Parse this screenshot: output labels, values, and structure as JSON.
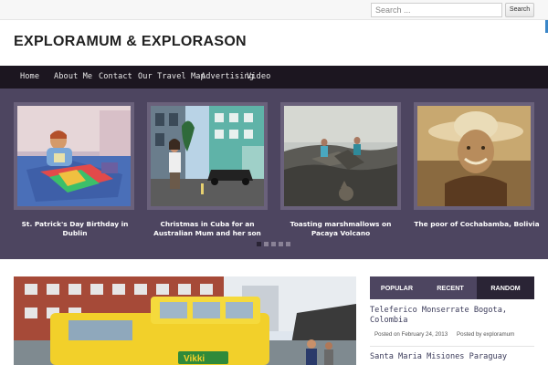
{
  "search": {
    "placeholder": "Search ...",
    "button_label": "Search"
  },
  "site": {
    "title": "EXPLORAMUM & EXPLORASON"
  },
  "nav": {
    "items": [
      {
        "label": "Home"
      },
      {
        "label": "About Me"
      },
      {
        "label": "Contact"
      },
      {
        "label": "Our Travel Map"
      },
      {
        "label": "Advertising"
      },
      {
        "label": "Video"
      }
    ]
  },
  "slider": {
    "slides": [
      {
        "caption": "St. Patrick's Day Birthday in Dublin"
      },
      {
        "caption": "Christmas in Cuba for an Australian Mum and her son"
      },
      {
        "caption": "Toasting marshmallows on Pacaya Volcano"
      },
      {
        "caption": "The poor of Cochabamba, Bolivia"
      }
    ],
    "active_dot": 1,
    "dot_count": 5
  },
  "tabs": {
    "items": [
      {
        "label": "POPULAR"
      },
      {
        "label": "RECENT"
      },
      {
        "label": "RANDOM"
      }
    ],
    "active": "RANDOM"
  },
  "posts": [
    {
      "title": "Teleferico Monserrate Bogota, Colombia",
      "date": "Posted on February 24, 2013",
      "author": "Posted by exploramum"
    },
    {
      "title": "Santa Maria Misiones Paraguay"
    }
  ],
  "colors": {
    "accent": "#4d4560",
    "nav_bg": "#1c1620",
    "active_tab": "#2a2435",
    "corner": "#3a86c8"
  },
  "feature_image": {
    "sign_text": "Vikki"
  }
}
